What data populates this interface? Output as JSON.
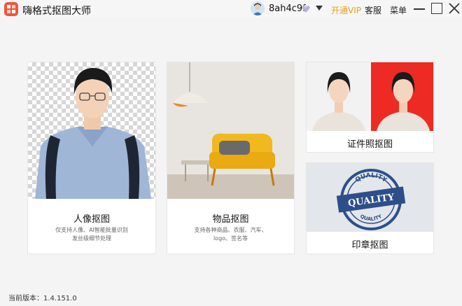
{
  "app": {
    "title": "嗨格式抠图大师"
  },
  "header": {
    "username": "8ah4c9f",
    "open_vip": "开通VIP",
    "service": "客服",
    "menu": "菜单"
  },
  "cards": {
    "portrait": {
      "title": "人像抠图",
      "desc_line1": "仅支持人像、AI智能批量识别",
      "desc_line2": "发丝级细节处理"
    },
    "object": {
      "title": "物品抠图",
      "desc_line1": "支持各种商品、衣服、汽车、",
      "desc_line2": "logo、签名等"
    },
    "id_photo": {
      "title": "证件照抠图"
    },
    "stamp": {
      "title": "印章抠图",
      "stamp_top": "QUALITY",
      "stamp_center": "QUALITY",
      "stamp_bottom": "QUALITY"
    }
  },
  "footer": {
    "version": "当前版本：1.4.151.0"
  },
  "colors": {
    "accent": "#f0553a",
    "vip": "#e8a21a",
    "stamp_blue": "#2c4f8a",
    "red_bg": "#ee2a24"
  },
  "icons": [
    "app-logo-icon",
    "user-avatar-icon",
    "vip-diamond-icon",
    "chevron-down-icon",
    "minimize-icon",
    "maximize-icon",
    "close-icon"
  ]
}
